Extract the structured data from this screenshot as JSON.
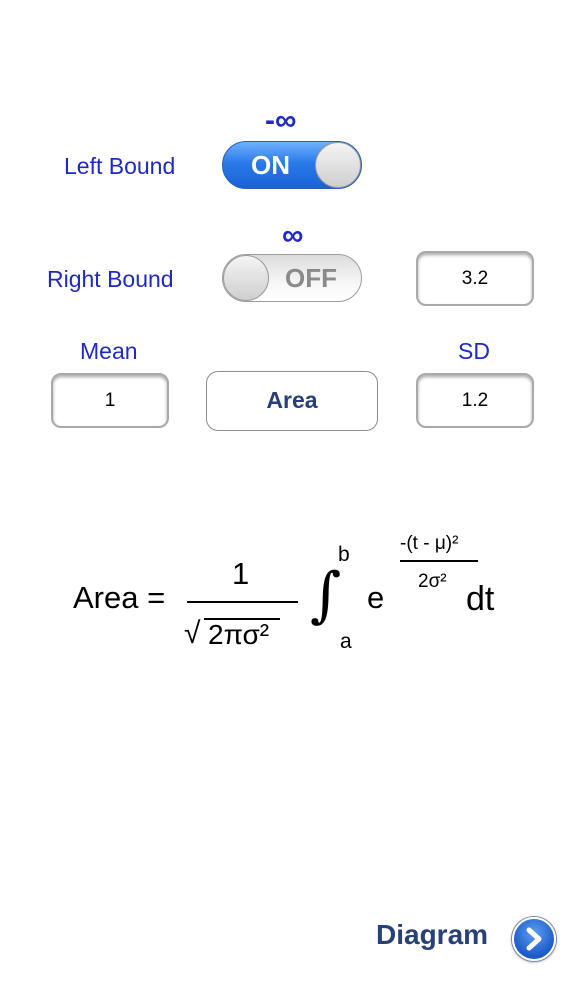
{
  "left_bound": {
    "label": "Left Bound",
    "symbol": "-∞",
    "toggle_state": "ON"
  },
  "right_bound": {
    "label": "Right Bound",
    "symbol": "∞",
    "toggle_state": "OFF",
    "value": "3.2"
  },
  "mean": {
    "label": "Mean",
    "value": "1"
  },
  "sd": {
    "label": "SD",
    "value": "1.2"
  },
  "area_button": {
    "label": "Area"
  },
  "formula": {
    "lhs": "Area =",
    "numerator": "1",
    "sqrt_symbol": "√",
    "denominator": "2πσ²",
    "integral_symbol": "∫",
    "upper_limit": "b",
    "lower_limit": "a",
    "base": "e",
    "exp_numerator": "-(t - μ)²",
    "exp_denominator": "2σ²",
    "differential": "dt"
  },
  "diagram": {
    "label": "Diagram",
    "icon": "chevron-right-circle-icon"
  },
  "colors": {
    "label_blue": "#1f29c8",
    "button_text": "#27407a",
    "toggle_on": "#2a7ae8"
  }
}
